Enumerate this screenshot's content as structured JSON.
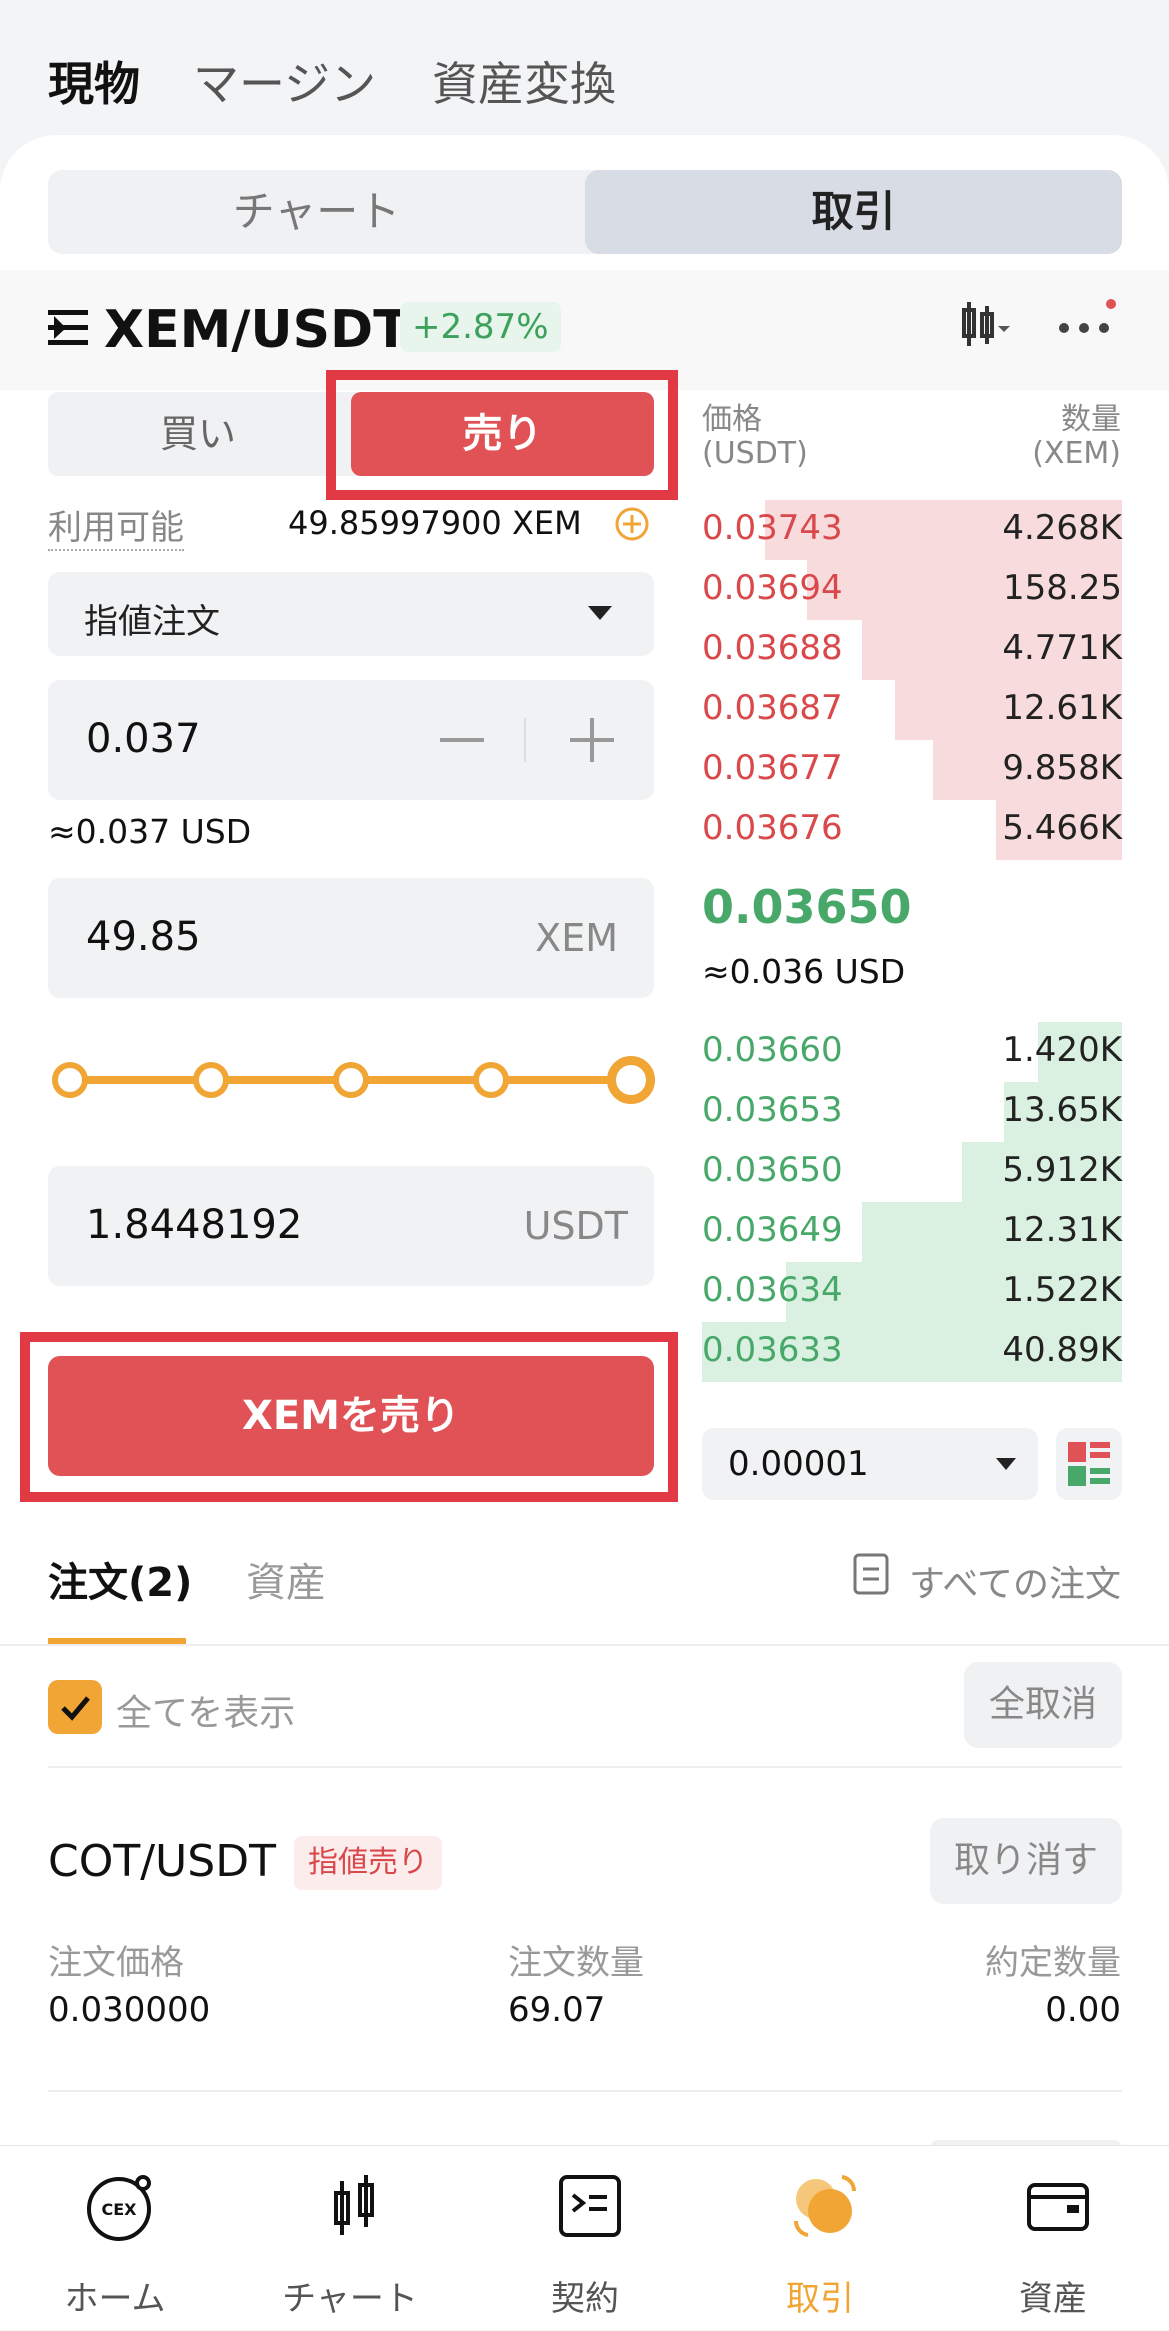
{
  "top_tabs": [
    "現物",
    "マージン",
    "資産変換"
  ],
  "segment": {
    "chart": "チャート",
    "trade": "取引"
  },
  "pair": {
    "name": "XEM/USDT",
    "change": "+2.87%"
  },
  "form": {
    "buy": "買い",
    "sell": "売り",
    "available_label": "利用可能",
    "available_value": "49.85997900 XEM",
    "order_type": "指値注文",
    "price": "0.037",
    "price_usd": "≈0.037 USD",
    "amount": "49.85",
    "amount_unit": "XEM",
    "total": "1.8448192",
    "total_unit": "USDT",
    "submit": "XEMを売り",
    "slider_percent": 100
  },
  "orderbook": {
    "price_header": "価格",
    "price_unit": "(USDT)",
    "qty_header": "数量",
    "qty_unit": "(XEM)",
    "asks": [
      {
        "p": "0.03743",
        "q": "4.268K",
        "depth": 0.85
      },
      {
        "p": "0.03694",
        "q": "158.25",
        "depth": 0.75
      },
      {
        "p": "0.03688",
        "q": "4.771K",
        "depth": 0.62
      },
      {
        "p": "0.03687",
        "q": "12.61K",
        "depth": 0.54
      },
      {
        "p": "0.03677",
        "q": "9.858K",
        "depth": 0.45
      },
      {
        "p": "0.03676",
        "q": "5.466K",
        "depth": 0.3
      }
    ],
    "last_price": "0.03650",
    "last_usd": "≈0.036 USD",
    "bids": [
      {
        "p": "0.03660",
        "q": "1.420K",
        "depth": 0.2
      },
      {
        "p": "0.03653",
        "q": "13.65K",
        "depth": 0.28
      },
      {
        "p": "0.03650",
        "q": "5.912K",
        "depth": 0.38
      },
      {
        "p": "0.03649",
        "q": "12.31K",
        "depth": 0.62
      },
      {
        "p": "0.03634",
        "q": "1.522K",
        "depth": 0.8
      },
      {
        "p": "0.03633",
        "q": "40.89K",
        "depth": 1.0
      }
    ],
    "precision": "0.00001"
  },
  "orders": {
    "tab_orders": "注文(2)",
    "tab_assets": "資産",
    "all_orders": "すべての注文",
    "show_all": "全てを表示",
    "cancel_all": "全取消",
    "item": {
      "pair": "COT/USDT",
      "tag": "指値売り",
      "cancel": "取り消す",
      "h_price": "注文価格",
      "h_qty": "注文数量",
      "h_filled": "約定数量",
      "price": "0.030000",
      "qty": "69.07",
      "filled": "0.00"
    }
  },
  "nav": [
    {
      "label": "ホーム",
      "icon": "cex-home-icon"
    },
    {
      "label": "チャート",
      "icon": "candlestick-icon"
    },
    {
      "label": "契約",
      "icon": "contract-icon"
    },
    {
      "label": "取引",
      "icon": "trade-icon"
    },
    {
      "label": "資産",
      "icon": "wallet-icon"
    }
  ],
  "colors": {
    "red": "#e05255",
    "green": "#48a86a",
    "accent": "#f0a535"
  }
}
